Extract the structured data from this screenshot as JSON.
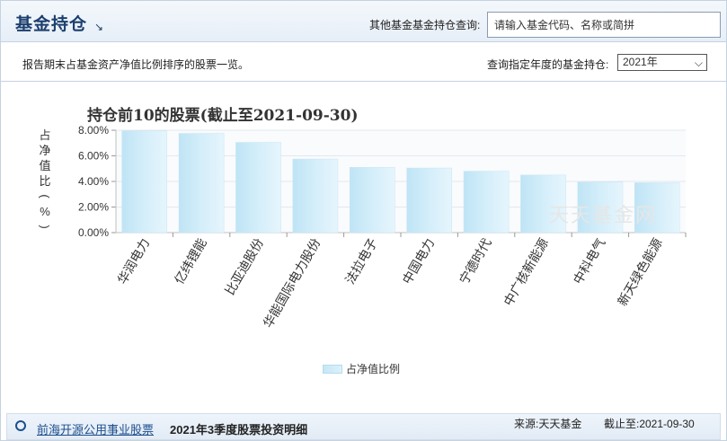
{
  "header": {
    "title": "基金持仓",
    "query_label": "其他基金基金持仓查询:",
    "search_placeholder": "请输入基金代码、名称或简拼"
  },
  "infobar": {
    "description": "报告期末占基金资产净值比例排序的股票一览。",
    "year_label": "查询指定年度的基金持仓:",
    "year_selected": "2021年"
  },
  "chart_data": {
    "type": "bar",
    "title": "持仓前10的股票(截止至2021-09-30)",
    "ylabel": "占净值比(%)",
    "ylabel_chars": [
      "占",
      "净",
      "值",
      "比",
      "(",
      "%",
      ")"
    ],
    "ylim": [
      0,
      8
    ],
    "yticks": [
      "0.00%",
      "2.00%",
      "4.00%",
      "6.00%",
      "8.00%"
    ],
    "categories": [
      "华润电力",
      "亿纬锂能",
      "比亚迪股份",
      "华能国际电力股份",
      "法拉电子",
      "中国电力",
      "宁德时代",
      "中广核新能源",
      "中科电气",
      "新天绿色能源"
    ],
    "series": [
      {
        "name": "占净值比例",
        "values": [
          7.95,
          7.75,
          7.05,
          5.75,
          5.1,
          5.05,
          4.8,
          4.5,
          3.95,
          3.9
        ]
      }
    ],
    "grid": true,
    "legend": "bottom-center",
    "bar_color": "#cdeaf7"
  },
  "watermark": "天天基金网",
  "footer": {
    "fund_name": "前海开源公用事业股票",
    "report_title": "2021年3季度股票投资明细",
    "source": "来源:天天基金",
    "deadline": "截止至:2021-09-30"
  }
}
